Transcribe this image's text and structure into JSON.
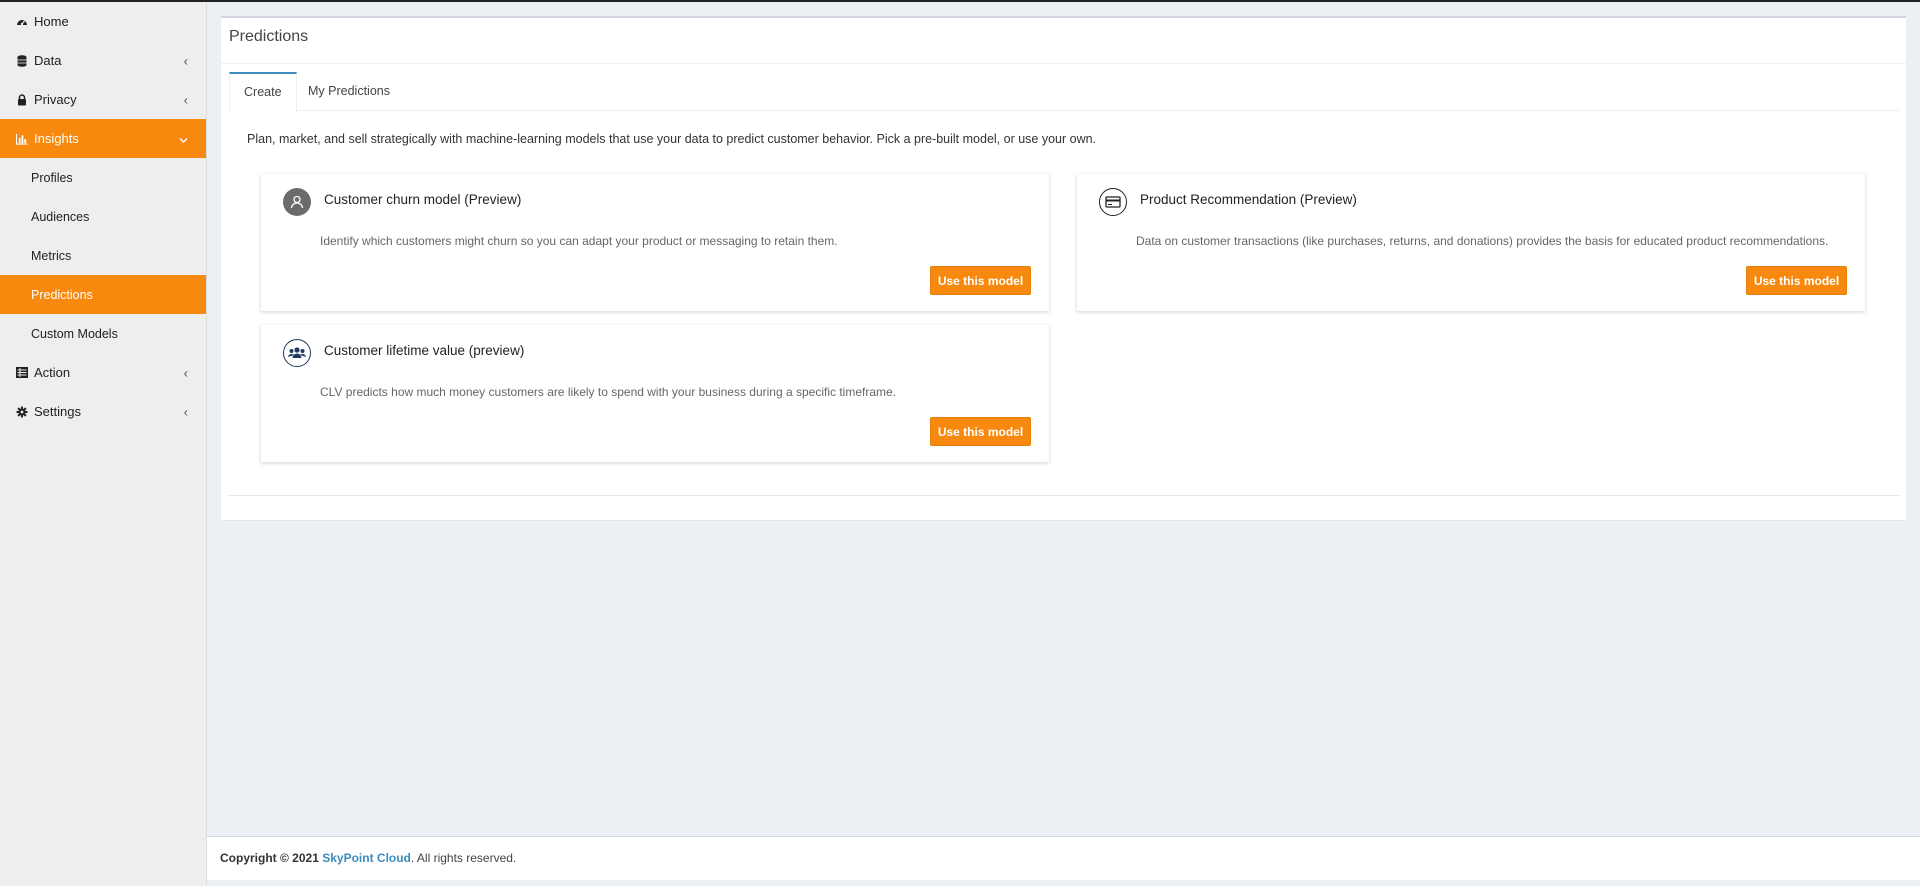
{
  "sidebar": {
    "home": "Home",
    "data": "Data",
    "privacy": "Privacy",
    "insights": "Insights",
    "insights_sub": [
      "Profiles",
      "Audiences",
      "Metrics",
      "Predictions",
      "Custom Models"
    ],
    "action": "Action",
    "settings": "Settings"
  },
  "panel": {
    "title": "Predictions",
    "tabs": [
      "Create",
      "My Predictions"
    ],
    "intro": "Plan, market, and sell strategically with machine-learning models that use your data to predict customer behavior. Pick a pre-built model, or use your own."
  },
  "cards": [
    {
      "title": "Customer churn model (Preview)",
      "description": "Identify which customers might churn so you can adapt your product or messaging to retain them.",
      "button": "Use this model",
      "icon": "user-icon"
    },
    {
      "title": "Product Recommendation (Preview)",
      "description": "Data on customer transactions (like purchases, returns, and donations) provides the basis for educated product recommendations.",
      "button": "Use this model",
      "icon": "credit-card-icon"
    },
    {
      "title": "Customer lifetime value (preview)",
      "description": "CLV predicts how much money customers are likely to spend with your business during a specific timeframe.",
      "button": "Use this model",
      "icon": "users-group-icon"
    }
  ],
  "footer": {
    "copyright": "Copyright © 2021",
    "brand": "SkyPoint Cloud",
    "rights": ". All rights reserved."
  },
  "colors": {
    "accent": "#f7890f",
    "link": "#3c8dbc",
    "background": "#ecf0f5"
  }
}
